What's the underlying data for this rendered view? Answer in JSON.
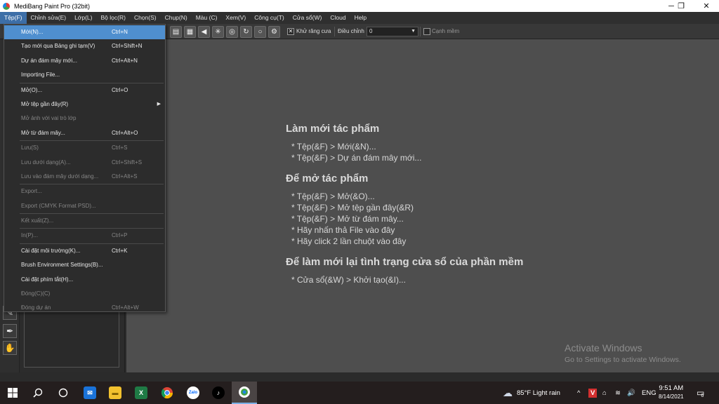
{
  "window": {
    "title": "MediBang Paint Pro (32bit)",
    "controls": {
      "minimize": "─",
      "maximize": "❐",
      "close": "✕"
    }
  },
  "menubar": {
    "items": [
      "Tệp(F)",
      "Chỉnh sửa(E)",
      "Lớp(L)",
      "Bộ lọc(R)",
      "Chọn(S)",
      "Chụp(N)",
      "Màu (C)",
      "Xem(V)",
      "Công cụ(T)",
      "Cửa sổ(W)",
      "Cloud",
      "Help"
    ],
    "active": 0
  },
  "toolbar": {
    "antialias_label": "Khử răng cưa",
    "adjust_label": "Điều chỉnh",
    "adjust_value": "0",
    "edge_label": "Cạnh mềm"
  },
  "file_menu": {
    "items": [
      {
        "label": "Mới(N)...",
        "shortcut": "Ctrl+N",
        "enabled": true,
        "highlight": true
      },
      {
        "label": "Tạo mới qua Bảng ghi tạm(V)",
        "shortcut": "Ctrl+Shift+N",
        "enabled": true
      },
      {
        "label": "Dự án đám mây mới...",
        "shortcut": "Ctrl+Alt+N",
        "enabled": true
      },
      {
        "label": "Importing File...",
        "shortcut": "",
        "enabled": true,
        "sep_after": true
      },
      {
        "label": "Mở(O)...",
        "shortcut": "Ctrl+O",
        "enabled": true
      },
      {
        "label": "Mở tệp gần đây(R)",
        "shortcut": "",
        "enabled": true,
        "submenu": true
      },
      {
        "label": "Mở ảnh với vai trò lớp",
        "shortcut": "",
        "enabled": false
      },
      {
        "label": "Mở từ đám mây...",
        "shortcut": "Ctrl+Alt+O",
        "enabled": true,
        "sep_after": true
      },
      {
        "label": "Lưu(S)",
        "shortcut": "Ctrl+S",
        "enabled": false
      },
      {
        "label": "Lưu dưới dạng(A)...",
        "shortcut": "Ctrl+Shift+S",
        "enabled": false
      },
      {
        "label": "Lưu vào đám mây dưới dạng...",
        "shortcut": "Ctrl+Alt+S",
        "enabled": false,
        "sep_after": true
      },
      {
        "label": "Export...",
        "shortcut": "",
        "enabled": false
      },
      {
        "label": "Export (CMYK Format PSD)...",
        "shortcut": "",
        "enabled": false,
        "sep_after": true
      },
      {
        "label": "Kết xuất(Z)...",
        "shortcut": "",
        "enabled": false,
        "sep_after": true
      },
      {
        "label": "In(P)...",
        "shortcut": "Ctrl+P",
        "enabled": false,
        "sep_after": true
      },
      {
        "label": "Cài đặt môi trường(K)...",
        "shortcut": "Ctrl+K",
        "enabled": true
      },
      {
        "label": "Brush Environment Settings(B)...",
        "shortcut": "",
        "enabled": true
      },
      {
        "label": "Cài đặt phím tắt(H)...",
        "shortcut": "",
        "enabled": true
      },
      {
        "label": "Đóng(C)(C)",
        "shortcut": "",
        "enabled": false
      },
      {
        "label": "Đóng dự án",
        "shortcut": "Ctrl+Alt+W",
        "enabled": false
      }
    ]
  },
  "welcome": {
    "new_heading": "Làm mới tác phẩm",
    "new_lines": [
      "* Tệp(&F) > Mới(&N)...",
      "* Tệp(&F) > Dự án đám mây mới..."
    ],
    "open_heading": "Để mở tác phẩm",
    "open_lines": [
      "* Tệp(&F) > Mở(&O)...",
      "* Tệp(&F) > Mở tệp gần đây(&R)",
      "* Tệp(&F) > Mở từ đám mây...",
      "* Hãy nhấn thả File vào đây",
      "* Hãy click 2 lần chuột vào đây"
    ],
    "reset_heading": "Để làm mới lại tình trạng cửa sổ của phần mềm",
    "reset_lines": [
      "* Cửa sổ(&W) > Khởi tạo(&I)..."
    ]
  },
  "watermark": {
    "line1": "Activate Windows",
    "line2": "Go to Settings to activate Windows."
  },
  "taskbar": {
    "weather": "85°F  Light rain",
    "language": "ENG",
    "time": "9:51 AM",
    "date": "8/14/2021",
    "notifications": "6",
    "excel_label": "X",
    "zalo_label": "Zalo",
    "v_label": "V"
  }
}
